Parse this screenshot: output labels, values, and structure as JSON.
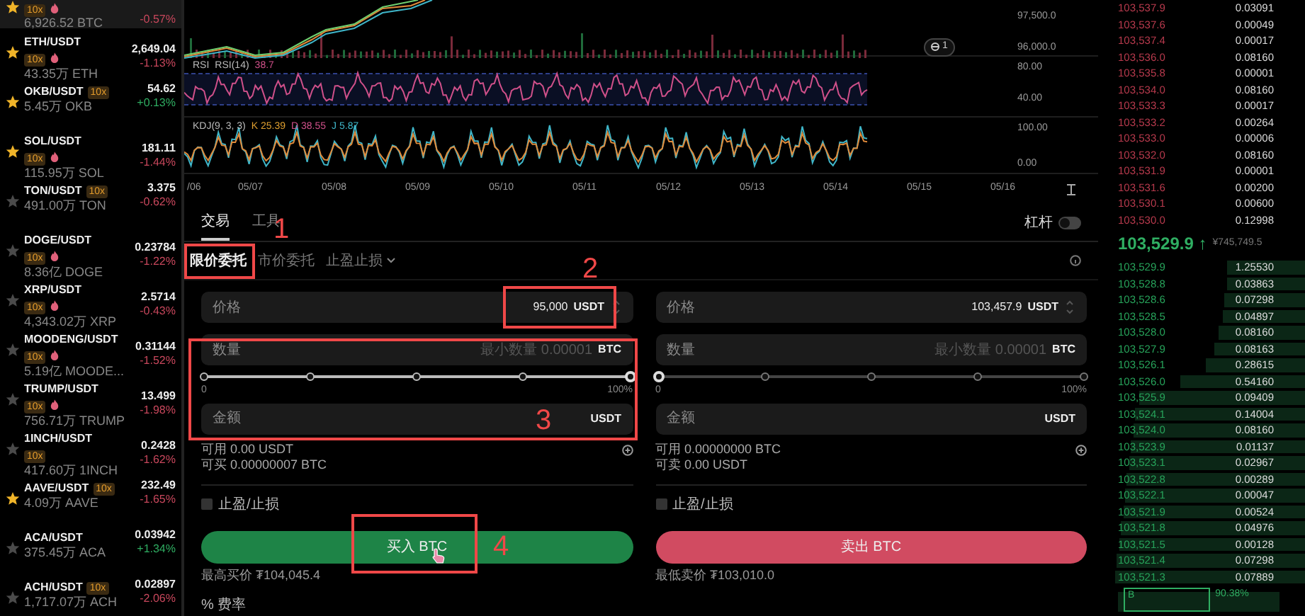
{
  "markets": [
    {
      "selected": true,
      "favorite": true,
      "kind": "stacked",
      "leverage": "10x",
      "hot": true,
      "volume": "6,926.52 BTC",
      "change": "-0.57%",
      "color": "#c8475c"
    },
    {
      "selected": false,
      "favorite": true,
      "kind": "stacked",
      "pair": "ETH/USDT",
      "leverage": "10x",
      "hot": true,
      "volume": "43.35万 ETH",
      "price": "2,649.04",
      "change": "-1.13%",
      "color": "#c8475c"
    },
    {
      "selected": false,
      "favorite": true,
      "kind": "inline",
      "pair": "OKB/USDT",
      "leverage": "10x",
      "hot": false,
      "volume": "5.45万 OKB",
      "price": "54.62",
      "change": "+0.13%",
      "color": "#2fae62"
    },
    {
      "selected": false,
      "favorite": true,
      "kind": "stacked",
      "pair": "SOL/USDT",
      "leverage": "10x",
      "hot": true,
      "volume": "115.95万 SOL",
      "price": "181.11",
      "change": "-1.44%",
      "color": "#c8475c"
    },
    {
      "selected": false,
      "favorite": false,
      "kind": "inline",
      "pair": "TON/USDT",
      "leverage": "10x",
      "hot": false,
      "volume": "491.00万 TON",
      "price": "3.375",
      "change": "-0.62%",
      "color": "#c8475c"
    },
    {
      "selected": false,
      "favorite": false,
      "kind": "stacked",
      "pair": "DOGE/USDT",
      "leverage": "10x",
      "hot": true,
      "volume": "8.36亿 DOGE",
      "price": "0.23784",
      "change": "-1.22%",
      "color": "#c8475c"
    },
    {
      "selected": false,
      "favorite": false,
      "kind": "stacked",
      "pair": "XRP/USDT",
      "leverage": "10x",
      "hot": true,
      "volume": "4,343.02万 XRP",
      "price": "2.5714",
      "change": "-0.43%",
      "color": "#c8475c"
    },
    {
      "selected": false,
      "favorite": false,
      "kind": "stacked",
      "pair": "MOODENG/USDT",
      "leverage": "10x",
      "hot": true,
      "volume": "5.19亿 MOODE...",
      "price": "0.31144",
      "change": "-1.52%",
      "color": "#c8475c"
    },
    {
      "selected": false,
      "favorite": false,
      "kind": "stacked",
      "pair": "TRUMP/USDT",
      "leverage": "10x",
      "hot": true,
      "volume": "756.71万 TRUMP",
      "price": "13.499",
      "change": "-1.98%",
      "color": "#c8475c"
    },
    {
      "selected": false,
      "favorite": false,
      "kind": "stacked",
      "pair": "1INCH/USDT",
      "leverage": "10x",
      "hot": false,
      "volume": "417.60万 1INCH",
      "price": "0.2428",
      "change": "-1.62%",
      "color": "#c8475c"
    },
    {
      "selected": false,
      "favorite": true,
      "kind": "inline",
      "pair": "AAVE/USDT",
      "leverage": "10x",
      "hot": false,
      "volume": "4.09万 AAVE",
      "price": "232.49",
      "change": "-1.65%",
      "color": "#c8475c"
    },
    {
      "selected": false,
      "favorite": false,
      "kind": "inline",
      "pair": "ACA/USDT",
      "hot": false,
      "volume": "375.45万 ACA",
      "price": "0.03942",
      "change": "+1.34%",
      "color": "#2fae62"
    },
    {
      "selected": false,
      "favorite": false,
      "kind": "inline",
      "pair": "ACH/USDT",
      "leverage": "10x",
      "hot": false,
      "volume": "1,717.07万 ACH",
      "price": "0.02897",
      "change": "-2.06%",
      "color": "#c8475c"
    }
  ],
  "chart": {
    "price_axis": [
      "97,500.0",
      "96,000.0"
    ],
    "marker": "1",
    "rsi": {
      "name": "RSI",
      "params": "RSI(14)",
      "value": "38.7",
      "axis": [
        "80.00",
        "40.00"
      ]
    },
    "kdj": {
      "params": "KDJ(9, 3, 3)",
      "k": "K 25.39",
      "d": "D 38.55",
      "j": "J 5.87",
      "axis": [
        "100.00",
        "0.00"
      ]
    },
    "dates": [
      "/06",
      "05/07",
      "05/08",
      "05/09",
      "05/10",
      "05/11",
      "05/12",
      "05/13",
      "05/14",
      "05/15",
      "05/16"
    ]
  },
  "trade": {
    "tabs": [
      {
        "label": "交易",
        "selected": true
      },
      {
        "label": "工具",
        "selected": false
      }
    ],
    "leverage": {
      "label": "杠杆",
      "on": false
    },
    "order_types": [
      {
        "label": "限价委托",
        "selected": true,
        "dropdown": false
      },
      {
        "label": "市价委托",
        "selected": false,
        "dropdown": false
      },
      {
        "label": "止盈止损",
        "selected": false,
        "dropdown": true
      }
    ],
    "sides": [
      {
        "kind": "buy",
        "price_label": "价格",
        "price": "95,000",
        "price_unit": "USDT",
        "qty_label": "数量",
        "qty_placeholder": "最小数量 0.00001",
        "qty_unit": "BTC",
        "level": 1,
        "slider_min": "0",
        "slider_max": "100%",
        "amount_label": "金额",
        "amount_unit": "USDT",
        "balances": [
          "可用 0.00 USDT",
          "可买 0.00000007 BTC"
        ],
        "tpsl": {
          "label": "止盈/止损",
          "checked": false
        },
        "button": "买入 BTC",
        "best": "最高买价 ₮104,045.4",
        "fee": "% 费率"
      },
      {
        "kind": "sell",
        "price_label": "价格",
        "price": "103,457.9",
        "price_unit": "USDT",
        "qty_label": "数量",
        "qty_placeholder": "最小数量 0.00001",
        "qty_unit": "BTC",
        "level": 0,
        "slider_min": "0",
        "slider_max": "100%",
        "amount_label": "金额",
        "amount_unit": "USDT",
        "balances": [
          "可用 0.00000000 BTC",
          "可卖 0.00 USDT"
        ],
        "tpsl": {
          "label": "止盈/止损",
          "checked": false
        },
        "button": "卖出 BTC",
        "best": "最低卖价 ₮103,010.0"
      }
    ]
  },
  "order_book": {
    "asks": [
      {
        "price": "103,537.9",
        "qty": "0.03091"
      },
      {
        "price": "103,537.6",
        "qty": "0.00049"
      },
      {
        "price": "103,537.4",
        "qty": "0.00017"
      },
      {
        "price": "103,536.0",
        "qty": "0.08160"
      },
      {
        "price": "103,535.8",
        "qty": "0.00001"
      },
      {
        "price": "103,534.0",
        "qty": "0.08160"
      },
      {
        "price": "103,533.3",
        "qty": "0.00017"
      },
      {
        "price": "103,533.2",
        "qty": "0.00264"
      },
      {
        "price": "103,533.0",
        "qty": "0.00006"
      },
      {
        "price": "103,532.0",
        "qty": "0.08160"
      },
      {
        "price": "103,531.9",
        "qty": "0.00001"
      },
      {
        "price": "103,531.6",
        "qty": "0.00200"
      },
      {
        "price": "103,530.1",
        "qty": "0.00600"
      },
      {
        "price": "103,530.0",
        "qty": "0.12998"
      }
    ],
    "mid": {
      "price": "103,529.9",
      "arrow": "↑",
      "fiat": "¥745,749.5"
    },
    "bids": [
      {
        "price": "103,529.9",
        "qty": "1.25530"
      },
      {
        "price": "103,528.8",
        "qty": "0.03863"
      },
      {
        "price": "103,528.6",
        "qty": "0.07298"
      },
      {
        "price": "103,528.5",
        "qty": "0.04897"
      },
      {
        "price": "103,528.0",
        "qty": "0.08160"
      },
      {
        "price": "103,527.9",
        "qty": "0.08163"
      },
      {
        "price": "103,526.1",
        "qty": "0.28615"
      },
      {
        "price": "103,526.0",
        "qty": "0.54160"
      },
      {
        "price": "103,525.9",
        "qty": "0.09409"
      },
      {
        "price": "103,524.1",
        "qty": "0.14004"
      },
      {
        "price": "103,524.0",
        "qty": "0.08160"
      },
      {
        "price": "103,523.9",
        "qty": "0.01137"
      },
      {
        "price": "103,523.1",
        "qty": "0.02967"
      },
      {
        "price": "103,522.8",
        "qty": "0.00289"
      },
      {
        "price": "103,522.1",
        "qty": "0.00047"
      },
      {
        "price": "103,521.9",
        "qty": "0.00524"
      },
      {
        "price": "103,521.8",
        "qty": "0.04976"
      },
      {
        "price": "103,521.5",
        "qty": "0.00128"
      },
      {
        "price": "103,521.4",
        "qty": "0.07298"
      },
      {
        "price": "103,521.3",
        "qty": "0.07889"
      }
    ],
    "ratio": {
      "label": "B",
      "value": "90.38%"
    }
  },
  "annotations": [
    {
      "label": "1"
    },
    {
      "label": "2"
    },
    {
      "label": "3"
    },
    {
      "label": "4"
    }
  ]
}
